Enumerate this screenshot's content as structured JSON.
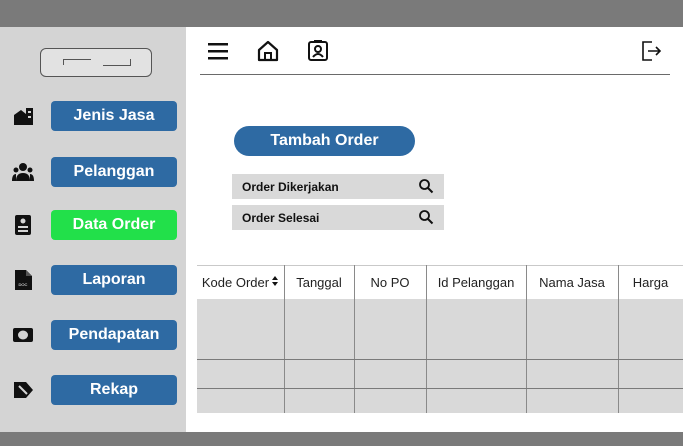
{
  "sidebar": {
    "items": [
      {
        "label": "Jenis Jasa",
        "icon": "building-icon",
        "active": false
      },
      {
        "label": "Pelanggan",
        "icon": "users-icon",
        "active": false
      },
      {
        "label": "Data Order",
        "icon": "clipboard-icon",
        "active": true
      },
      {
        "label": "Laporan",
        "icon": "doc-file-icon",
        "active": false
      },
      {
        "label": "Pendapatan",
        "icon": "cash-icon",
        "active": false
      },
      {
        "label": "Rekap",
        "icon": "tag-arrow-icon",
        "active": false
      }
    ]
  },
  "topnav": {
    "icons": [
      "menu-icon",
      "home-icon",
      "contact-card-icon",
      "logout-icon"
    ]
  },
  "main": {
    "add_button": "Tambah Order",
    "search_rows": [
      {
        "label": "Order Dikerjakan"
      },
      {
        "label": "Order Selesai"
      }
    ]
  },
  "table": {
    "columns": [
      "Kode Order",
      "Tanggal",
      "No PO",
      "Id Pelanggan",
      "Nama Jasa",
      "Harga"
    ],
    "rows": []
  },
  "colors": {
    "primary": "#2e6aa3",
    "active": "#22e04a",
    "sidebar_bg": "#d4d4d4",
    "bar": "#7a7a7a"
  }
}
